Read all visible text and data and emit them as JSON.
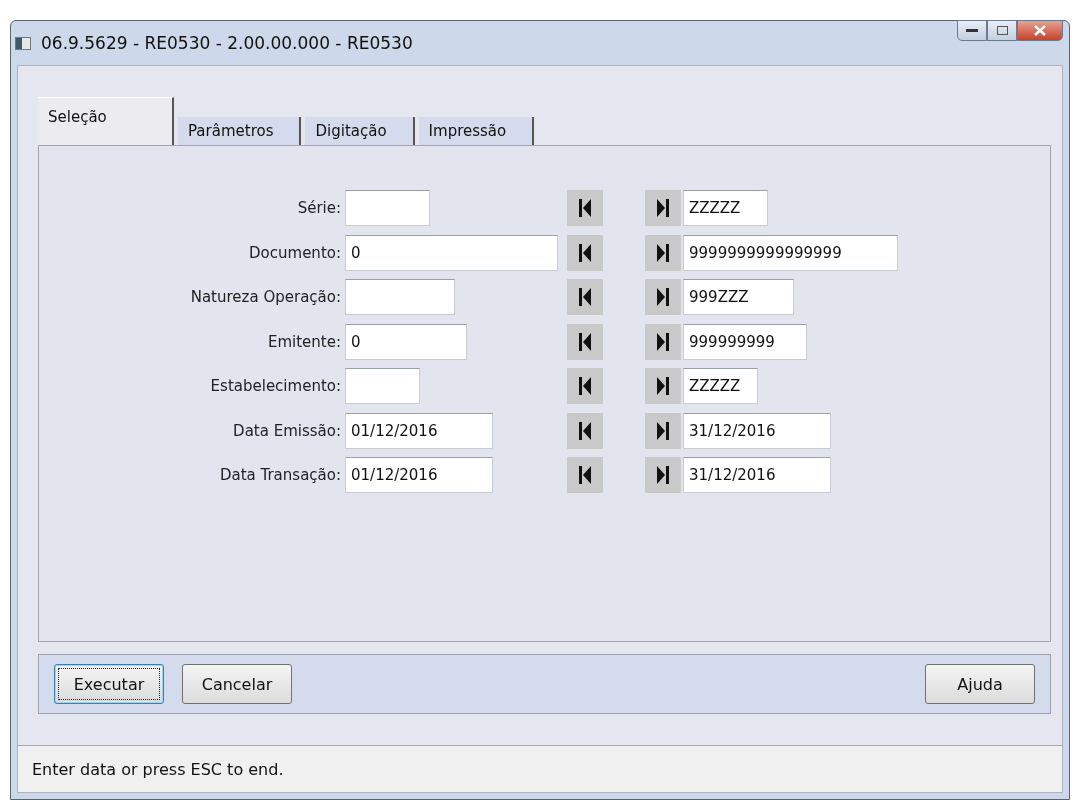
{
  "window": {
    "title": "06.9.5629 - RE0530 - 2.00.00.000 - RE0530"
  },
  "tabs": [
    {
      "label": "Seleção",
      "selected": true
    },
    {
      "label": "Parâmetros",
      "selected": false
    },
    {
      "label": "Digitação",
      "selected": false
    },
    {
      "label": "Impressão",
      "selected": false
    }
  ],
  "fields": [
    {
      "label": "Série:",
      "to": "ZZZZZ"
    },
    {
      "label": "Documento:",
      "from": "0",
      "to": "9999999999999999"
    },
    {
      "label": "Natureza Operação:",
      "to": "999ZZZ"
    },
    {
      "label": "Emitente:",
      "from": "0",
      "to": "999999999"
    },
    {
      "label": "Estabelecimento:",
      "to": "ZZZZZ"
    },
    {
      "label": "Data Emissão:",
      "from": "01/12/2016",
      "to": "31/12/2016"
    },
    {
      "label": "Data Transação:",
      "from": "01/12/2016",
      "to": "31/12/2016"
    }
  ],
  "buttons_left": [
    {
      "label": "Executar",
      "focused": true
    },
    {
      "label": "Cancelar",
      "focused": false
    }
  ],
  "buttons_right": [
    {
      "label": "Ajuda",
      "focused": false
    }
  ],
  "status_bar": "Enter data or press ESC to end."
}
